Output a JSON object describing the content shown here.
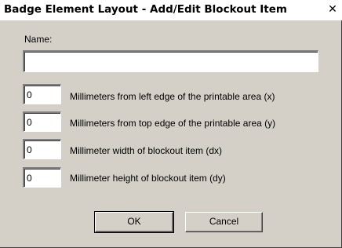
{
  "window": {
    "title": "Badge Element Layout - Add/Edit Blockout Item",
    "close_symbol": "✕"
  },
  "form": {
    "name_label": "Name:",
    "name_value": "",
    "fields": [
      {
        "value": "0",
        "label": "Millimeters from left edge of the printable area (x)"
      },
      {
        "value": "0",
        "label": "Millimeters from top edge of the printable area (y)"
      },
      {
        "value": "0",
        "label": "Millimeter width of blockout item (dx)"
      },
      {
        "value": "0",
        "label": "Millimeter height of blockout item (dy)"
      }
    ]
  },
  "buttons": {
    "ok_label": "OK",
    "cancel_label": "Cancel"
  },
  "icons": {
    "close": "close-icon"
  }
}
